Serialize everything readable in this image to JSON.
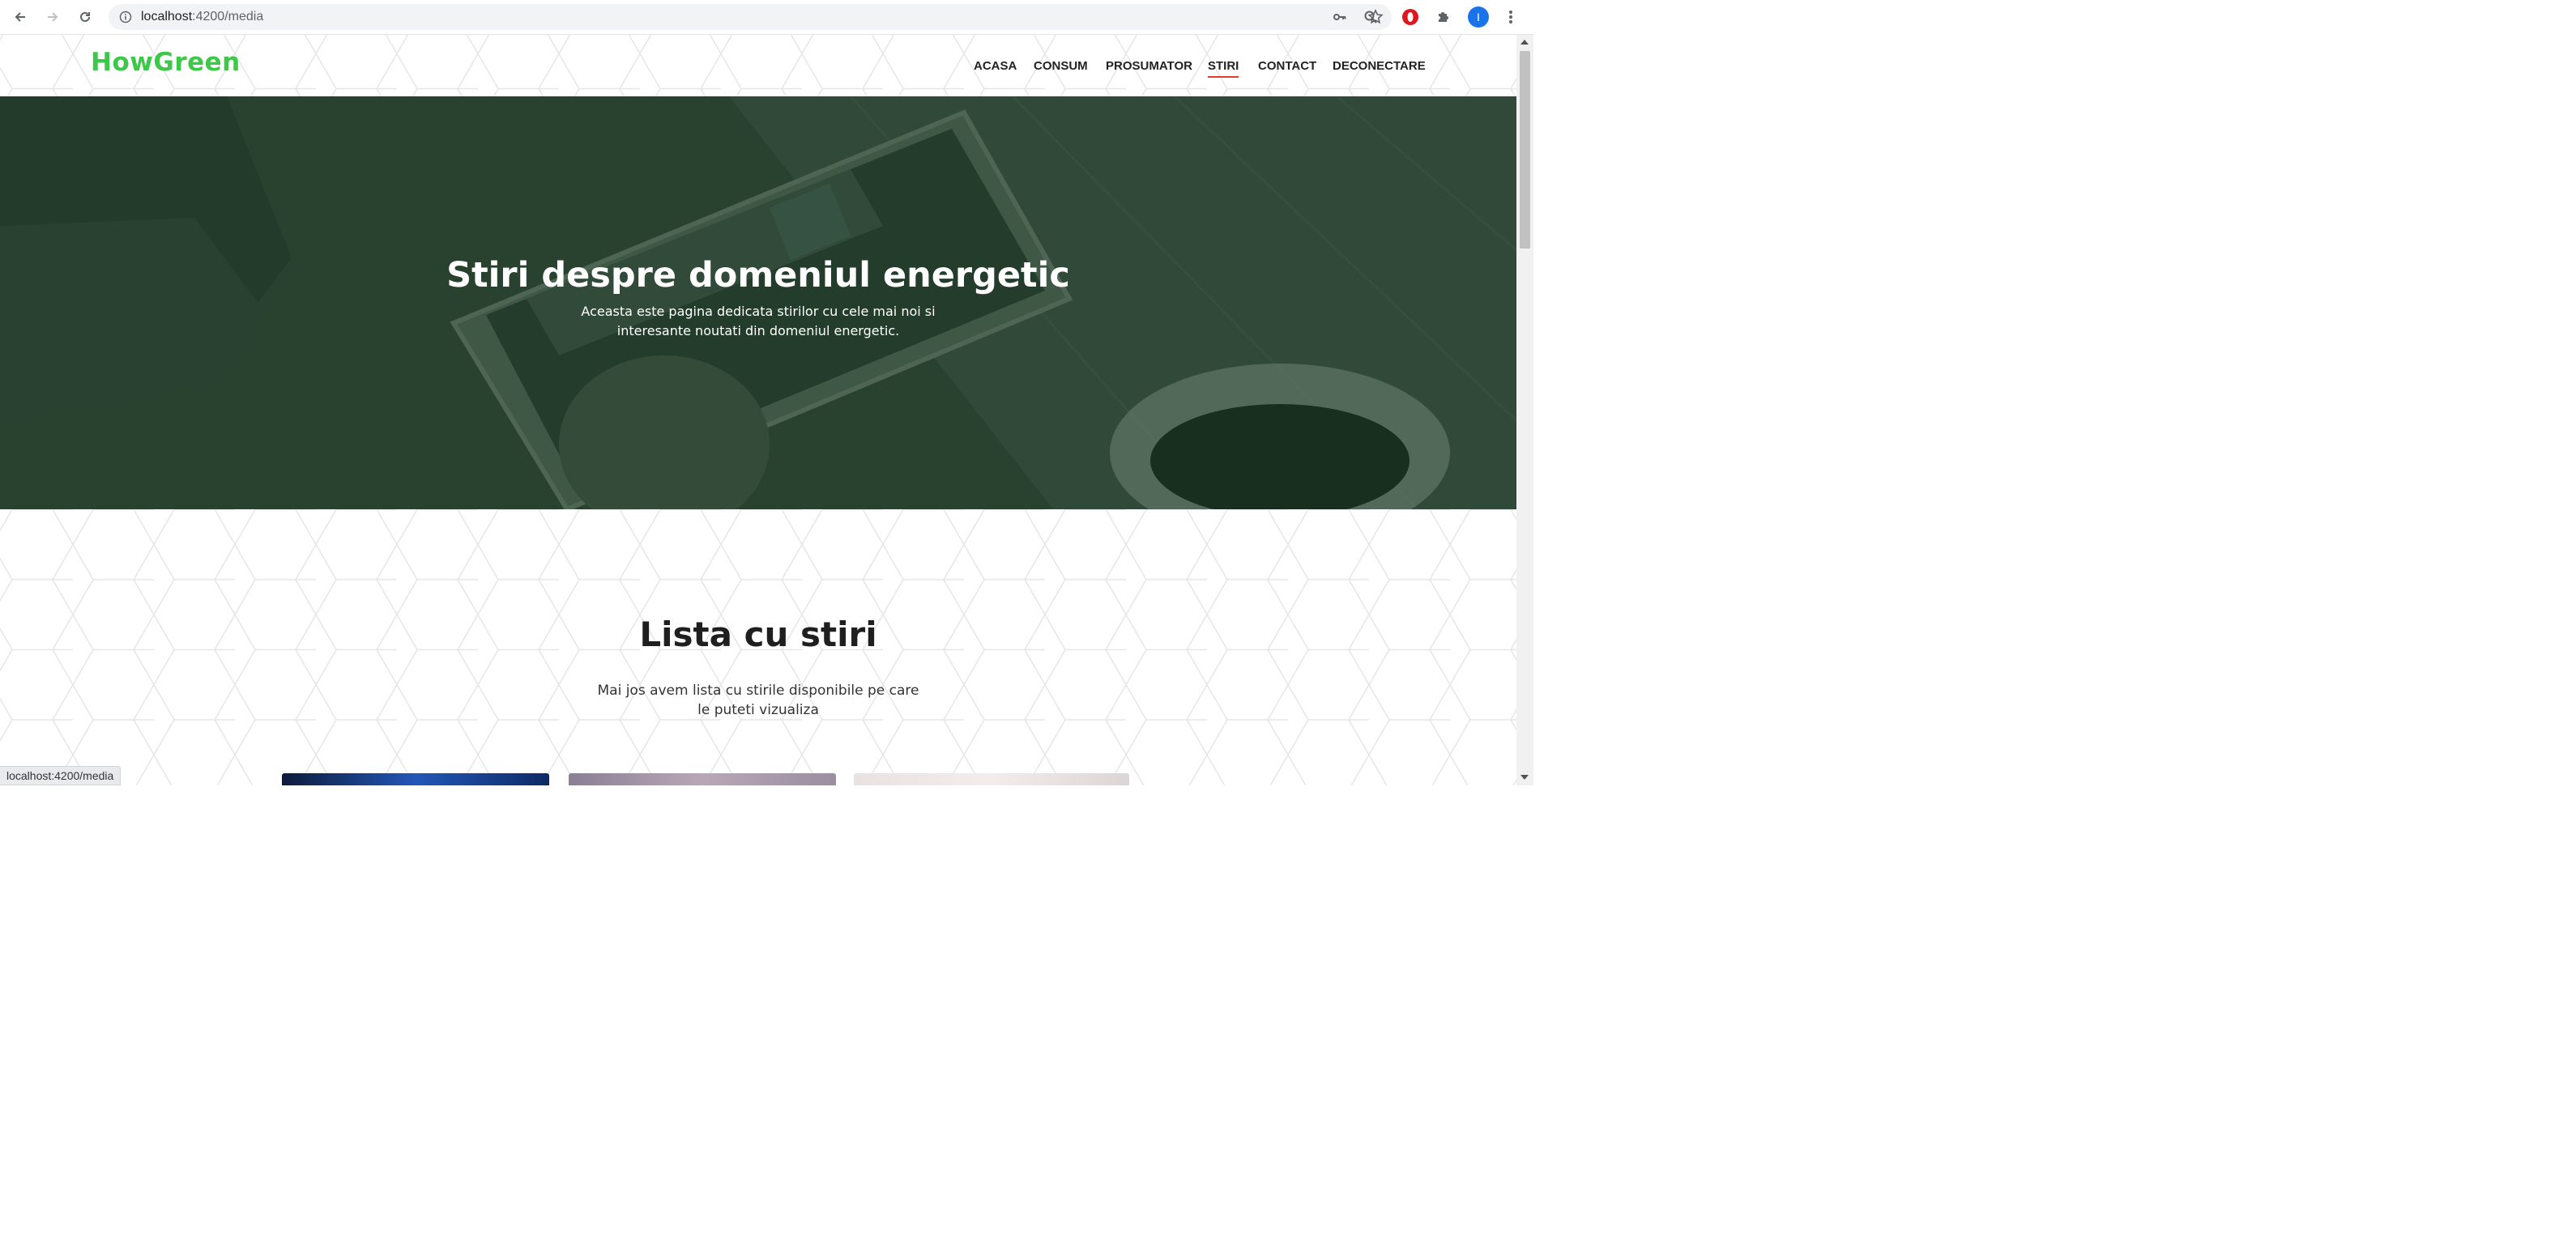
{
  "browser": {
    "url_host": "localhost",
    "url_path": ":4200/media",
    "profile_initial": "I"
  },
  "site": {
    "logo": "HowGreen",
    "menu": [
      {
        "label": "ACASA"
      },
      {
        "label": "CONSUM"
      },
      {
        "label": "PROSUMATOR"
      },
      {
        "label": "STIRI",
        "active": true
      },
      {
        "label": "CONTACT"
      },
      {
        "label": "DECONECTARE"
      }
    ],
    "accent_color": "#3ec84a",
    "active_underline_color": "#e63b2b"
  },
  "hero": {
    "title": "Stiri despre domeniul energetic",
    "subtitle": "Aceasta este pagina dedicata stirilor cu cele mai noi si interesante noutati din domeniul energetic."
  },
  "news_section": {
    "title": "Lista cu stiri",
    "subtitle": "Mai jos avem lista cu stirile disponibile pe care le puteti vizualiza"
  },
  "status_bar": {
    "text": "localhost:4200/media"
  }
}
